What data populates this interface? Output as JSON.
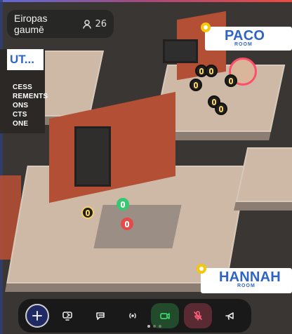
{
  "room": {
    "title": "Eiropas gaumē",
    "participants": "26"
  },
  "labels": {
    "paco": {
      "main": "PACO",
      "sub": "ROOM"
    },
    "hannah": {
      "main": "HANNAH",
      "sub": "ROOM"
    },
    "left_badge": "UT...",
    "left_lines": [
      "CESS",
      "REMENTS",
      "ONS",
      "CTS",
      "ONE"
    ]
  },
  "icons": {
    "people": "people-icon",
    "add": "plus-icon",
    "share": "share-screen-icon",
    "chat": "chat-icon",
    "broadcast": "broadcast-icon",
    "camera": "camera-icon",
    "mic": "mic-muted-icon",
    "megaphone": "megaphone-icon"
  },
  "toolbar": {
    "pagination": {
      "count": 3,
      "active_index": 0
    }
  },
  "colors": {
    "camera_active": "#3bd46a",
    "mic_muted": "#ff5f7a",
    "label_blue": "#2f64c7",
    "pin_yellow": "#f4c70d"
  }
}
